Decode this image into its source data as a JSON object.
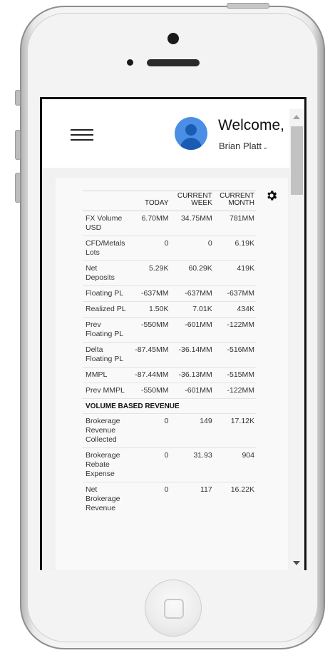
{
  "header": {
    "welcome": "Welcome,",
    "username": "Brian Platt",
    "chevron": "⌄"
  },
  "table": {
    "columns": [
      "TODAY",
      "CURRENT WEEK",
      "CURRENT MONTH"
    ],
    "col_lines": [
      [
        "TODAY"
      ],
      [
        "CURRENT",
        "WEEK"
      ],
      [
        "CURRENT",
        "MONTH"
      ]
    ],
    "rows": [
      {
        "label": "FX Volume USD",
        "values": [
          "6.70MM",
          "34.75MM",
          "781MM"
        ]
      },
      {
        "label": "CFD/Metals Lots",
        "values": [
          "0",
          "0",
          "6.19K"
        ]
      },
      {
        "label": "Net Deposits",
        "values": [
          "5.29K",
          "60.29K",
          "419K"
        ]
      },
      {
        "label": "Floating PL",
        "values": [
          "-637MM",
          "-637MM",
          "-637MM"
        ]
      },
      {
        "label": "Realized PL",
        "values": [
          "1.50K",
          "7.01K",
          "434K"
        ]
      },
      {
        "label": "Prev Floating PL",
        "values": [
          "-550MM",
          "-601MM",
          "-122MM"
        ]
      },
      {
        "label": "Delta Floating PL",
        "values": [
          "-87.45MM",
          "-36.14MM",
          "-516MM"
        ]
      },
      {
        "label": "MMPL",
        "values": [
          "-87.44MM",
          "-36.13MM",
          "-515MM"
        ]
      },
      {
        "label": "Prev MMPL",
        "values": [
          "-550MM",
          "-601MM",
          "-122MM"
        ]
      }
    ],
    "section_title": "VOLUME BASED REVENUE",
    "section_rows": [
      {
        "label": "Brokerage Revenue Collected",
        "values": [
          "0",
          "149",
          "17.12K"
        ]
      },
      {
        "label": "Brokerage Rebate Expense",
        "values": [
          "0",
          "31.93",
          "904"
        ]
      },
      {
        "label": "Net Brokerage Revenue",
        "values": [
          "0",
          "117",
          "16.22K"
        ]
      }
    ]
  },
  "icons": {
    "menu": "hamburger-menu-icon",
    "avatar": "user-avatar-icon",
    "settings": "gear-icon"
  }
}
